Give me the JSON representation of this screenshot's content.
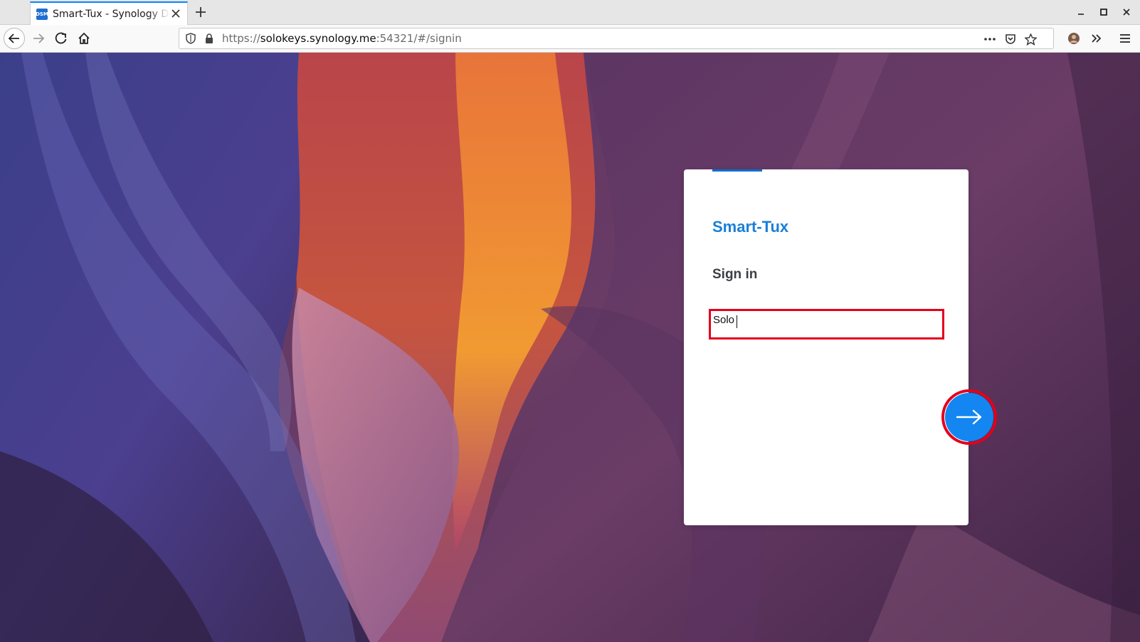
{
  "browser": {
    "tab": {
      "title": "Smart-Tux - Synology DiskStation",
      "favicon_text": "DSM",
      "close_icon": "close-icon"
    },
    "new_tab_icon": "plus-icon",
    "window_controls": [
      "minimize-icon",
      "maximize-icon",
      "close-icon"
    ],
    "url": {
      "prefix": "https://",
      "host": "solokeys.synology.me",
      "rest": ":54321/#/signin"
    },
    "accent_color": "#0a84ff"
  },
  "login": {
    "brand_name": "Smart-Tux",
    "heading": "Sign in",
    "username_value": "Solo",
    "brand_color": "#1a7fd9",
    "button_color": "#1386f2",
    "highlight_color": "#e3001b",
    "next_icon": "arrow-right-icon"
  }
}
